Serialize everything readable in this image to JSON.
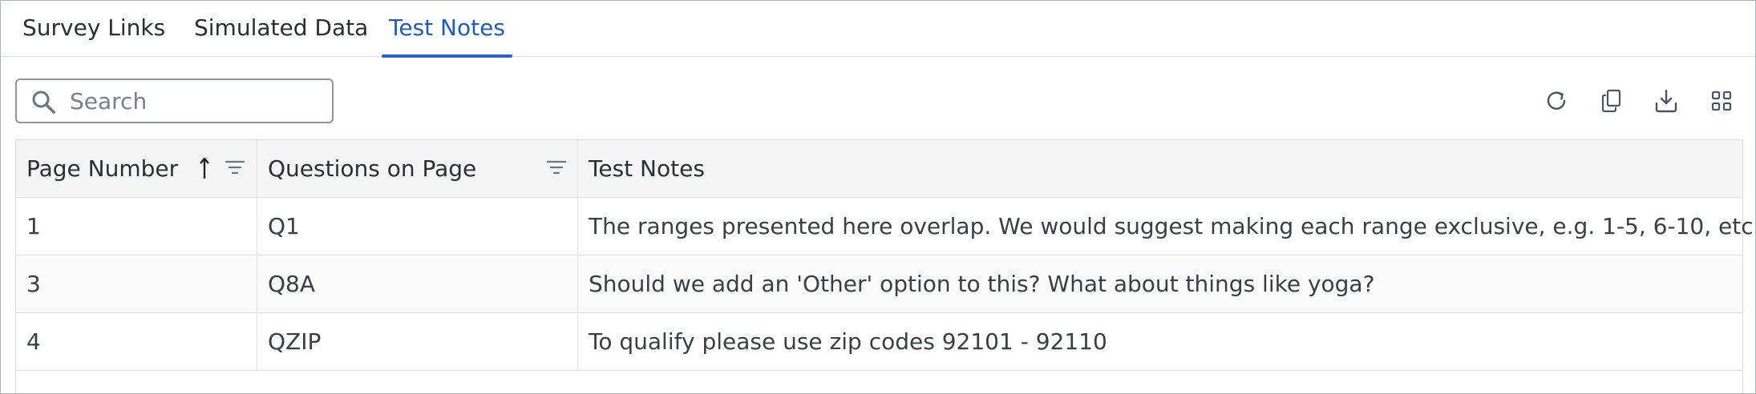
{
  "tabs": [
    {
      "label": "Survey Links",
      "active": false
    },
    {
      "label": "Simulated Data",
      "active": false
    },
    {
      "label": "Test Notes",
      "active": true
    }
  ],
  "toolbar": {
    "search_placeholder": "Search",
    "icons": [
      "refresh-icon",
      "copy-icon",
      "download-icon",
      "grid-view-icon"
    ]
  },
  "table": {
    "columns": [
      {
        "label": "Page Number",
        "sorted": "ascending",
        "filterable": true
      },
      {
        "label": "Questions on Page",
        "filterable": true
      },
      {
        "label": "Test Notes",
        "filterable": false
      }
    ],
    "rows": [
      {
        "page": "1",
        "question": "Q1",
        "note": "The ranges presented here overlap. We would suggest making each range exclusive, e.g. 1-5, 6-10, etc."
      },
      {
        "page": "3",
        "question": "Q8A",
        "note": "Should we add an 'Other' option to this? What about things like yoga?"
      },
      {
        "page": "4",
        "question": "QZIP",
        "note": "To qualify please use zip codes 92101 - 92110"
      }
    ]
  },
  "colors": {
    "accent": "#1f5bbf",
    "text": "#32363a",
    "header_bg": "#f5f5f5",
    "border": "#dde1e6"
  }
}
